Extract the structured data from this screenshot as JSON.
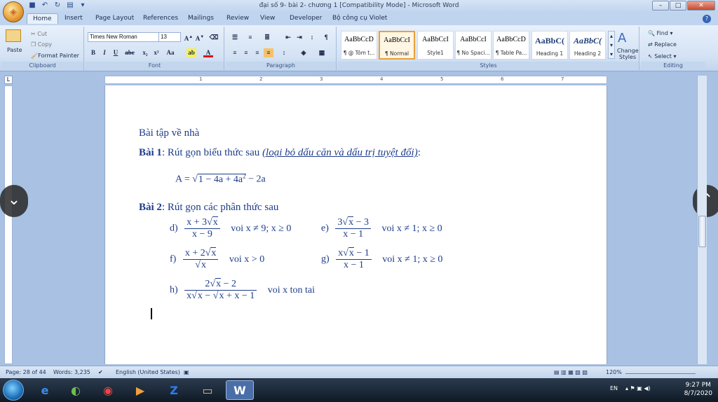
{
  "window": {
    "title": "đại số 9- bài 2- chương 1 [Compatibility Mode] - Microsoft Word",
    "controls": [
      "–",
      "□",
      "✕"
    ]
  },
  "ribbon_tabs": [
    "Home",
    "Insert",
    "Page Layout",
    "References",
    "Mailings",
    "Review",
    "View",
    "Developer",
    "Bộ công cụ Violet"
  ],
  "clipboard": {
    "paste": "Paste",
    "cut": "Cut",
    "copy": "Copy",
    "format_painter": "Format Painter",
    "label": "Clipboard"
  },
  "font": {
    "name": "Times New Roman",
    "size": "13",
    "label": "Font"
  },
  "paragraph": {
    "label": "Paragraph"
  },
  "styles": {
    "items": [
      {
        "sample": "AaBbCcD",
        "name": "¶ @ Tóm t..."
      },
      {
        "sample": "AaBbCcI",
        "name": "¶ Normal"
      },
      {
        "sample": "AaBbCcI",
        "name": "Style1"
      },
      {
        "sample": "AaBbCcI",
        "name": "¶ No Spaci..."
      },
      {
        "sample": "AaBbCcD",
        "name": "¶ Table Pa..."
      },
      {
        "sample": "AaBbC(",
        "name": "Heading 1"
      },
      {
        "sample": "AaBbC(",
        "name": "Heading 2"
      }
    ],
    "change_styles": "Change Styles",
    "label": "Styles"
  },
  "editing": {
    "find": "Find",
    "replace": "Replace",
    "select": "Select",
    "label": "Editing"
  },
  "document": {
    "heading": "Bài tập về nhà",
    "bai1_label": "Bài 1",
    "bai1_text": ": Rút gọn biểu thức sau ",
    "bai1_note": "(loại bỏ dấu căn và dấu trị tuyệt đối)",
    "bai1_colon": ":",
    "expr_a_lhs": "A =",
    "expr_a_rad": "1 − 4a + 4a",
    "expr_a_exp": "2",
    "expr_a_tail": "− 2a",
    "bai2_label": "Bài 2",
    "bai2_text": ": Rút gọn các phân thức sau",
    "items": [
      {
        "id": "d)",
        "num_pre": "x + 3",
        "num_rad": "x",
        "num_post": "",
        "den_pre": "x − 9",
        "den_rad": "",
        "cond": "voi x  ≠ 9; x ≥ 0"
      },
      {
        "id": "e)",
        "num_pre": "3",
        "num_rad": "x",
        "num_post": " − 3",
        "den_pre": "x − 1",
        "den_rad": "",
        "cond": "voi x  ≠ 1; x ≥ 0"
      },
      {
        "id": "f)",
        "num_pre": "x + 2",
        "num_rad": "x",
        "num_post": "",
        "den_pre": "",
        "den_rad": "x",
        "cond": "voi x > 0"
      },
      {
        "id": "g)",
        "num_pre": "x",
        "num_rad": "x",
        "num_post": " − 1",
        "den_pre": "x − 1",
        "den_rad": "",
        "cond": "voi x  ≠ 1; x ≥ 0"
      },
      {
        "id": "h)",
        "num_pre": "2",
        "num_rad": "x",
        "num_post": " − 2",
        "den_pre": "x",
        "den_rad": "x",
        "den_mid": " − ",
        "den_rad2": "x",
        "den_post": " + x − 1",
        "cond": "voi x ton tai"
      }
    ]
  },
  "statusbar": {
    "page": "Page: 28 of 44",
    "words": "Words: 3,235",
    "language": "English (United States)",
    "zoom": "120%"
  },
  "taskbar": {
    "lang": "EN",
    "time": "9:27 PM",
    "date": "8/7/2020"
  }
}
